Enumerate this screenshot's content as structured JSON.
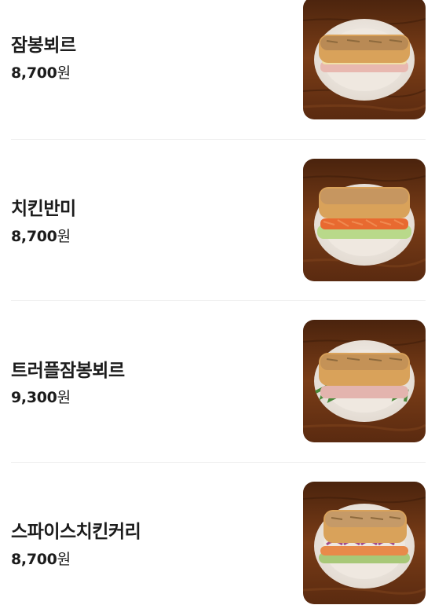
{
  "menu": {
    "items": [
      {
        "name": "잠봉뵈르",
        "price_number": "8,700",
        "price_unit": "원",
        "filling": "ham"
      },
      {
        "name": "치킨반미",
        "price_number": "8,700",
        "price_unit": "원",
        "filling": "carrot"
      },
      {
        "name": "트러플잠봉뵈르",
        "price_number": "9,300",
        "price_unit": "원",
        "filling": "ham-greens"
      },
      {
        "name": "스파이스치킨커리",
        "price_number": "8,700",
        "price_unit": "원",
        "filling": "chicken-onion"
      }
    ]
  },
  "colors": {
    "text": "#1c1c1c",
    "divider": "#f0f0f0",
    "wood": "#6b3414",
    "plate": "#f3ede6",
    "bread": "#d9a25a"
  }
}
